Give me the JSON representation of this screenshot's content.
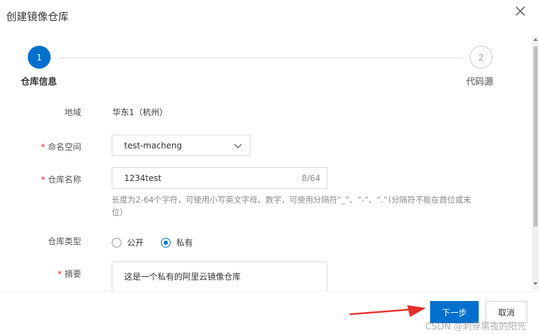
{
  "dialog": {
    "title": "创建镜像仓库",
    "close_icon": "close-icon"
  },
  "steps": [
    {
      "number": "1",
      "title": "仓库信息",
      "active": true
    },
    {
      "number": "2",
      "title": "代码源",
      "active": false
    }
  ],
  "form": {
    "region": {
      "label": "地域",
      "value": "华东1（杭州）"
    },
    "namespace": {
      "required_mark": "*",
      "label": "命名空间",
      "value": "test-macheng",
      "icon": "chevron-down-icon"
    },
    "repo_name": {
      "required_mark": "*",
      "label": "仓库名称",
      "value": "1234test",
      "counter": "8/64",
      "hint": "长度为2-64个字符，可使用小写英文字母、数字，可使用分隔符“_”、“-”、“.”（分隔符不能在首位或末位）"
    },
    "repo_type": {
      "label": "仓库类型",
      "options": [
        {
          "label": "公开",
          "selected": false
        },
        {
          "label": "私有",
          "selected": true
        }
      ]
    },
    "summary": {
      "required_mark": "*",
      "label": "摘要",
      "value": "这是一个私有的阿里云镜像仓库"
    }
  },
  "footer": {
    "next_label": "下一步",
    "cancel_label": "取消"
  },
  "colors": {
    "primary": "#0070cc",
    "required": "#e2231a",
    "annotation_arrow": "#e8302a"
  },
  "watermark": "CSDN @刺穿黑夜的阳光"
}
